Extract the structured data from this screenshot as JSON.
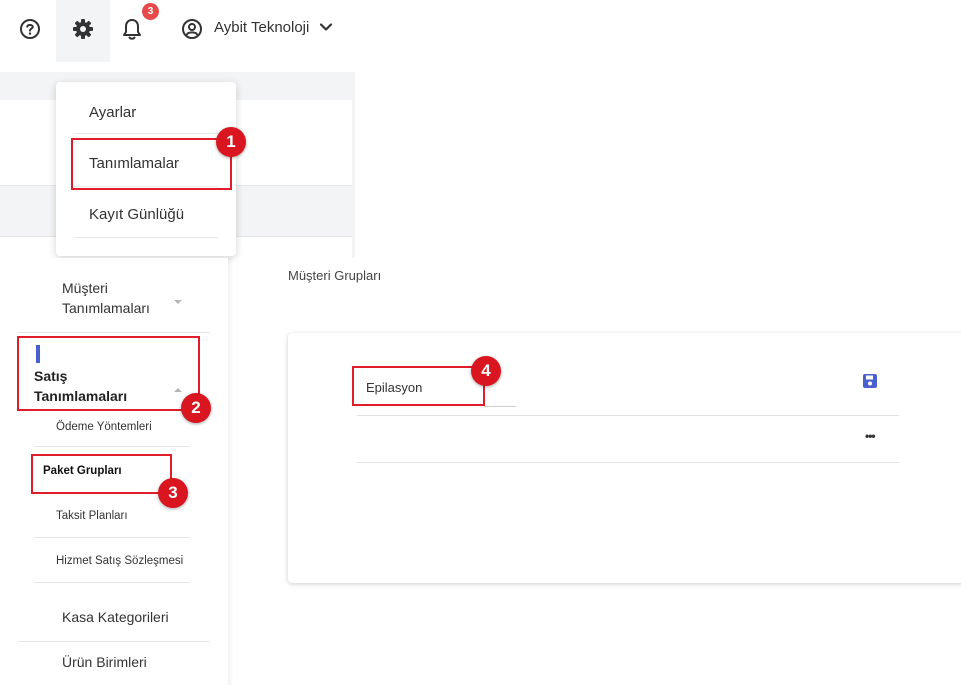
{
  "header": {
    "notification_count": "3",
    "company_name": "Aybit Teknoloji",
    "icons": [
      "help-icon",
      "gear-icon",
      "bell-icon",
      "user-circle-icon",
      "chevron-down-icon"
    ]
  },
  "settings_menu": {
    "items": [
      {
        "label": "Ayarlar"
      },
      {
        "label": "Tanımlamalar"
      },
      {
        "label": "Kayıt Günlüğü"
      }
    ]
  },
  "sidebar": {
    "musteri_tanimlamalari": "Müşteri Tanımlamaları",
    "satis_tanimlamalari": "Satış Tanımlamaları",
    "sub_items": [
      {
        "label": "Ödeme Yöntemleri"
      },
      {
        "label": "Paket Grupları"
      },
      {
        "label": "Taksit Planları"
      },
      {
        "label": "Hizmet Satış Sözleşmesi"
      }
    ],
    "kasa_kategorileri": "Kasa Kategorileri",
    "urun_birimleri": "Ürün Birimleri"
  },
  "main": {
    "breadcrumb": "Müşteri Grupları",
    "group_name_value": "Epilasyon",
    "more_label": "•••"
  },
  "annotations": {
    "markers": [
      "1",
      "2",
      "3",
      "4"
    ],
    "highlight_color": "#e11d2b",
    "marker_color": "#d9161f"
  },
  "colors": {
    "accent": "#4a5fd0",
    "badge": "#e64a4a"
  }
}
